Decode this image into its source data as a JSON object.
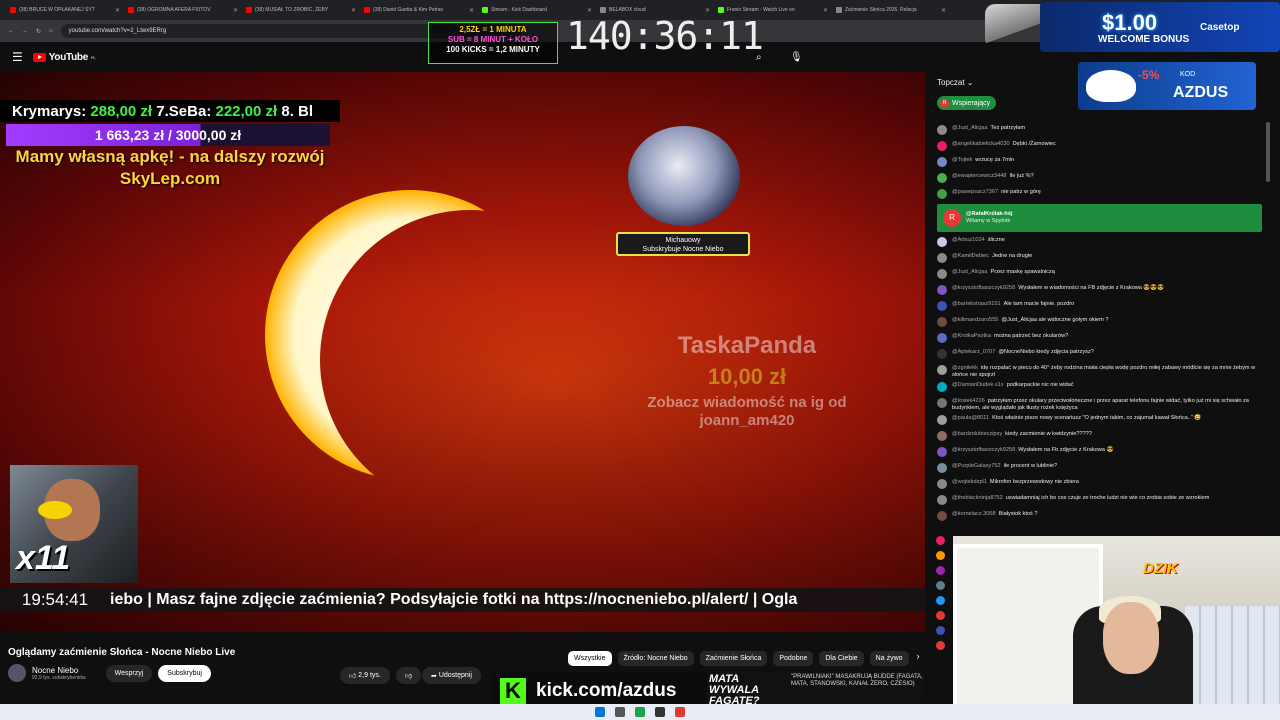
{
  "browser": {
    "tabs": [
      {
        "label": "(38) BRUCE W OPŁAKANEJ SYT",
        "color": "#ff0000"
      },
      {
        "label": "(38) OGROMNA AFERA FIUTOV",
        "color": "#ff0000"
      },
      {
        "label": "(38) MUSIAŁ TO ZROBIĆ, ŻEBY",
        "color": "#ff0000"
      },
      {
        "label": "(38) David Guetta & Kim Petras",
        "color": "#ff0000"
      },
      {
        "label": "Stream - Kick Dashboard",
        "color": "#53fc18"
      },
      {
        "label": "BELABOX cloud",
        "color": "#888888"
      },
      {
        "label": "Franio Stream - Watch Live on",
        "color": "#53fc18"
      },
      {
        "label": "Zaćmienie Słońca 2026. Relacja",
        "color": "#888888"
      }
    ],
    "url": "youtube.com/watch?v=2_Ltwx9ERrg"
  },
  "youtube": {
    "logo": "YouTube",
    "region": "PL"
  },
  "overlay": {
    "topbar": [
      {
        "name": "Krymarys:",
        "value": "288,00 zł"
      },
      {
        "name": "7.SeBa:",
        "value": "222,00 zł"
      },
      {
        "name": "8. Bl",
        "value": ""
      }
    ],
    "goal": "1 663,23 zł / 3000,00 zł",
    "promo_line1": "Mamy własną apkę! - na dalszy rozwój",
    "promo_line2": "SkyLep.com",
    "sub_name": "Michauowy",
    "sub_text": "Subskrybuje Nocne Niebo",
    "donor_name": "TaskaPanda",
    "donor_amount": "10,00 zł",
    "donor_msg1": "Zobacz wiadomość na ig od",
    "donor_msg2": "joann_am420",
    "multiplier": "x11",
    "clock": "19:54:41",
    "ticker": "iebo  |  Masz fajne zdjęcie zaćmienia?  Podsyłajcie fotki  na https://nocneniebo.pl/alert/  |  Ogla",
    "stream_timer": "140:36:11",
    "kick_goals": [
      "2,5ZŁ = 1 MINUTA",
      "SUB = 8 MINUT + KOŁO",
      "100 KICKS = 1,2 MINUTY"
    ],
    "casino_amount": "$1.00",
    "casino_bonus": "WELCOME BONUS",
    "casino_brand": "Casetop",
    "discount": "-5%",
    "code_label": "KOD",
    "code": "AZDUS",
    "kick_url": "kick.com/azdus",
    "kick_letter": "K",
    "cam2_logo": "DZIK",
    "news_big": "MATA WYWALA FAGATE?",
    "news_text": "\"PRAWILNIAKI\" MASAKRUJĄ BUDDE (FAGATA, MATA, STANOWSKI, KANAŁ ZERO, CZESIO)"
  },
  "video": {
    "title": "Oglądamy zaćmienie Słońca - Nocne Niebo Live",
    "channel": "Nocne Niebo",
    "subscribers": "92,9 tys. subskrybentów",
    "support_button": "Wesprzyj",
    "subscribe_button": "Subskrybuj",
    "likes": "2,9 tys.",
    "share": "Udostępnij"
  },
  "chips": [
    "Wszystkie",
    "Źródło: Nocne Niebo",
    "Zaćmienie Słońca",
    "Podobne",
    "Dla Ciebie",
    "Na żywo"
  ],
  "chat": {
    "header": "Topczat ⌄",
    "support_badge": "Wspierający",
    "messages": [
      {
        "author": "@Just_Alicjaa",
        "text": "Też patrzyłam",
        "color": "#8a8a8a"
      },
      {
        "author": "@angelikabielicka4030",
        "text": "Dębki /Żarnowiec",
        "color": "#e91e63"
      },
      {
        "author": "@Tojtek",
        "text": "wrzucę za 7min",
        "color": "#7986cb"
      },
      {
        "author": "@ewapiercewicz3448",
        "text": "Ile już %?",
        "color": "#4caf50"
      },
      {
        "author": "@pawepsacz7367",
        "text": "nie patrz w górę",
        "color": "#43a047"
      },
      {
        "author": "@RafałKróIak-hśj",
        "text": "Witamy w Spytnik",
        "color": "#e53935",
        "highlight": true,
        "initial": "R"
      },
      {
        "author": "@Arbuz1024",
        "text": "śliczne",
        "color": "#c5cae9"
      },
      {
        "author": "@KamilDebiec",
        "text": "Jedne na drugie",
        "color": "#8a8a8a"
      },
      {
        "author": "@Just_Alicjaa",
        "text": "Przez maskę spawalniczą",
        "color": "#8a8a8a"
      },
      {
        "author": "@krzysztofbaszczyk9258",
        "text": "Wysłałem w wiadomości na FB zdjęcie z Krakowa 😎😎😎",
        "color": "#7e57c2"
      },
      {
        "author": "@bartekstrasz9151",
        "text": "Ale tam macie fajnie. pozdro",
        "color": "#3f51b5"
      },
      {
        "author": "@kilimandzaro555",
        "text": "@Just_Alicjaa ale widoczne gołym okiem ?",
        "color": "#6d4c41"
      },
      {
        "author": "@KrotkaPsotka",
        "text": "można patrzeć bez okularów?",
        "color": "#5c6bc0"
      },
      {
        "author": "@Aptekarz_0707",
        "text": "@NocneNiebo kiedy zdjęcia patrzysz?",
        "color": "#333333"
      },
      {
        "author": "@zgnilekk",
        "text": "idę rozpalać w piecu do 40° żeby rodzina miała ciepła wodę pozdro miłej zabawy módlcie się za mnie żebym w słońce nie spojrzł",
        "color": "#9e9e9e"
      },
      {
        "author": "@DamianDudek-s1x",
        "text": "podkarpackie nic nie widać",
        "color": "#00acc1"
      },
      {
        "author": "@tosiek4226",
        "text": "patrzyłam przez okulary przeciwsłoneczne i przez aparat telefonu fajnie widać, tylko już mi się schwało za budynkiem, ale wyglądało jak tłusty rożek księżyca",
        "color": "#757575"
      },
      {
        "author": "@paula@8011",
        "text": "Ktoś właśnie pisze nowy scenariusz \"O jednym takim, co zajumał kawał Słońca..\" 😅",
        "color": "#9e9e9e"
      },
      {
        "author": "@bardzolubieczipsy",
        "text": "kiedy zacmienie w kwidzynie?????",
        "color": "#8d6e63"
      },
      {
        "author": "@krzysztofbaszczyk9258",
        "text": "Wysłałem na Fb zdjęcie z Krakowa 😎",
        "color": "#7e57c2"
      },
      {
        "author": "@PurpleGalaxy752",
        "text": "ile procent w lublinie?",
        "color": "#78909c"
      },
      {
        "author": "@wojtekdzpl1",
        "text": "Mikrofon bezprzewodowy nie zbiera",
        "color": "#8a8a8a"
      },
      {
        "author": "@theblackninja8752",
        "text": "uswiadamniaj ich bo cos czuje ze troche ludzi nie wie co zrobia sobie ze wzrokiem",
        "color": "#8a8a8a"
      },
      {
        "author": "@kornelacz.3068",
        "text": "Białystok ktoś ?",
        "color": "#6d4c41"
      }
    ]
  }
}
